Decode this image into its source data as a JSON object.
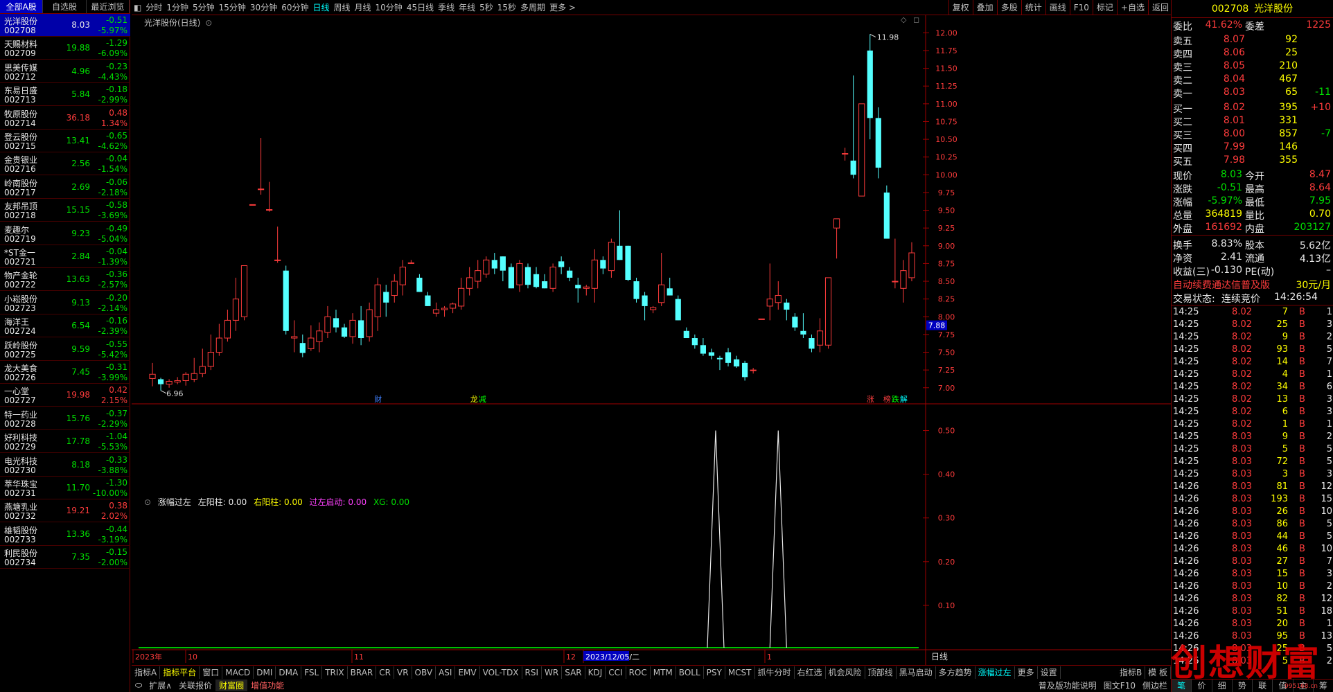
{
  "left_tabs": [
    "全部A股",
    "自选股",
    "最近浏览"
  ],
  "stocks": [
    {
      "name": "光洋股份",
      "code": "002708",
      "price": "8.03",
      "change": "-0.51",
      "pct": "-5.97%",
      "dir": "dn"
    },
    {
      "name": "天赐材料",
      "code": "002709",
      "price": "19.88",
      "change": "-1.29",
      "pct": "-6.09%",
      "dir": "dn"
    },
    {
      "name": "思美传媒",
      "code": "002712",
      "price": "4.96",
      "change": "-0.23",
      "pct": "-4.43%",
      "dir": "dn"
    },
    {
      "name": "东易日盛",
      "code": "002713",
      "price": "5.84",
      "change": "-0.18",
      "pct": "-2.99%",
      "dir": "dn"
    },
    {
      "name": "牧原股份",
      "code": "002714",
      "price": "36.18",
      "change": "0.48",
      "pct": "1.34%",
      "dir": "up"
    },
    {
      "name": "登云股份",
      "code": "002715",
      "price": "13.41",
      "change": "-0.65",
      "pct": "-4.62%",
      "dir": "dn"
    },
    {
      "name": "金贵银业",
      "code": "002716",
      "price": "2.56",
      "change": "-0.04",
      "pct": "-1.54%",
      "dir": "dn"
    },
    {
      "name": "岭南股份",
      "code": "002717",
      "price": "2.69",
      "change": "-0.06",
      "pct": "-2.18%",
      "dir": "dn"
    },
    {
      "name": "友邦吊顶",
      "code": "002718",
      "price": "15.15",
      "change": "-0.58",
      "pct": "-3.69%",
      "dir": "dn"
    },
    {
      "name": "麦趣尔",
      "code": "002719",
      "price": "9.23",
      "change": "-0.49",
      "pct": "-5.04%",
      "dir": "dn"
    },
    {
      "name": "*ST金一",
      "code": "002721",
      "price": "2.84",
      "change": "-0.04",
      "pct": "-1.39%",
      "dir": "dn"
    },
    {
      "name": "物产金轮",
      "code": "002722",
      "price": "13.63",
      "change": "-0.36",
      "pct": "-2.57%",
      "dir": "dn"
    },
    {
      "name": "小崧股份",
      "code": "002723",
      "price": "9.13",
      "change": "-0.20",
      "pct": "-2.14%",
      "dir": "dn"
    },
    {
      "name": "海洋王",
      "code": "002724",
      "price": "6.54",
      "change": "-0.16",
      "pct": "-2.39%",
      "dir": "dn"
    },
    {
      "name": "跃岭股份",
      "code": "002725",
      "price": "9.59",
      "change": "-0.55",
      "pct": "-5.42%",
      "dir": "dn"
    },
    {
      "name": "龙大美食",
      "code": "002726",
      "price": "7.45",
      "change": "-0.31",
      "pct": "-3.99%",
      "dir": "dn"
    },
    {
      "name": "一心堂",
      "code": "002727",
      "price": "19.98",
      "change": "0.42",
      "pct": "2.15%",
      "dir": "up"
    },
    {
      "name": "特一药业",
      "code": "002728",
      "price": "15.76",
      "change": "-0.37",
      "pct": "-2.29%",
      "dir": "dn"
    },
    {
      "name": "好利科技",
      "code": "002729",
      "price": "17.78",
      "change": "-1.04",
      "pct": "-5.53%",
      "dir": "dn"
    },
    {
      "name": "电光科技",
      "code": "002730",
      "price": "8.18",
      "change": "-0.33",
      "pct": "-3.88%",
      "dir": "dn"
    },
    {
      "name": "萃华珠宝",
      "code": "002731",
      "price": "11.70",
      "change": "-1.30",
      "pct": "-10.00%",
      "dir": "dn"
    },
    {
      "name": "燕塘乳业",
      "code": "002732",
      "price": "19.21",
      "change": "0.38",
      "pct": "2.02%",
      "dir": "up"
    },
    {
      "name": "雄韬股份",
      "code": "002733",
      "price": "13.36",
      "change": "-0.44",
      "pct": "-3.19%",
      "dir": "dn"
    },
    {
      "name": "利民股份",
      "code": "002734",
      "price": "7.35",
      "change": "-0.15",
      "pct": "-2.00%",
      "dir": "dn"
    }
  ],
  "period_tabs": [
    "分时",
    "1分钟",
    "5分钟",
    "15分钟",
    "30分钟",
    "60分钟",
    "日线",
    "周线",
    "月线",
    "10分钟",
    "45日线",
    "季线",
    "年线",
    "5秒",
    "15秒",
    "多周期",
    "更多 >"
  ],
  "active_period": "日线",
  "toolbar_right": [
    "复权",
    "叠加",
    "多股",
    "统计",
    "画线",
    "F10",
    "标记",
    "+自选",
    "返回"
  ],
  "chart_title": "光洋股份(日线)",
  "chart_data": {
    "type": "candlestick",
    "title": "光洋股份(日线)",
    "ylim": [
      6.9,
      12.15
    ],
    "yticks": [
      "12.00",
      "11.75",
      "11.50",
      "11.25",
      "11.00",
      "10.75",
      "10.50",
      "10.25",
      "10.00",
      "9.75",
      "9.50",
      "9.25",
      "9.00",
      "8.75",
      "8.50",
      "8.25",
      "8.00",
      "7.75",
      "7.50",
      "7.25",
      "7.00"
    ],
    "max_label": "11.98",
    "min_label": "6.96",
    "current_price_label": "7.88",
    "candles": [
      {
        "o": 7.13,
        "h": 7.35,
        "l": 7.02,
        "c": 7.19
      },
      {
        "o": 7.12,
        "h": 7.14,
        "l": 6.96,
        "c": 7.05
      },
      {
        "o": 7.05,
        "h": 7.12,
        "l": 7.0,
        "c": 7.09
      },
      {
        "o": 7.08,
        "h": 7.15,
        "l": 7.05,
        "c": 7.1
      },
      {
        "o": 7.1,
        "h": 7.22,
        "l": 7.03,
        "c": 7.19
      },
      {
        "o": 7.12,
        "h": 7.42,
        "l": 7.08,
        "c": 7.2
      },
      {
        "o": 7.2,
        "h": 7.55,
        "l": 7.15,
        "c": 7.3
      },
      {
        "o": 7.3,
        "h": 7.75,
        "l": 7.25,
        "c": 7.5
      },
      {
        "o": 7.5,
        "h": 7.9,
        "l": 7.45,
        "c": 7.7
      },
      {
        "o": 7.7,
        "h": 8.1,
        "l": 7.65,
        "c": 7.95
      },
      {
        "o": 7.95,
        "h": 8.55,
        "l": 7.8,
        "c": 8.25
      },
      {
        "o": 8.0,
        "h": 8.72,
        "l": 7.95,
        "c": 8.72
      },
      {
        "o": 9.58,
        "h": 9.58,
        "l": 9.58,
        "c": 9.58
      },
      {
        "o": 9.8,
        "h": 10.52,
        "l": 9.72,
        "c": 9.8
      },
      {
        "o": 9.51,
        "h": 9.9,
        "l": 9.48,
        "c": 9.51
      },
      {
        "o": 8.8,
        "h": 9.27,
        "l": 8.76,
        "c": 8.8
      },
      {
        "o": 8.65,
        "h": 8.72,
        "l": 7.75,
        "c": 7.8
      },
      {
        "o": 7.7,
        "h": 7.95,
        "l": 7.5,
        "c": 7.72
      },
      {
        "o": 7.63,
        "h": 7.75,
        "l": 7.43,
        "c": 7.49
      },
      {
        "o": 7.55,
        "h": 7.88,
        "l": 7.52,
        "c": 7.7
      },
      {
        "o": 7.65,
        "h": 7.92,
        "l": 7.5,
        "c": 7.8
      },
      {
        "o": 7.78,
        "h": 8.15,
        "l": 7.7,
        "c": 8.0
      },
      {
        "o": 7.98,
        "h": 8.1,
        "l": 7.78,
        "c": 7.85
      },
      {
        "o": 7.85,
        "h": 7.9,
        "l": 7.7,
        "c": 7.72
      },
      {
        "o": 7.72,
        "h": 8.05,
        "l": 7.62,
        "c": 7.95
      },
      {
        "o": 7.95,
        "h": 8.15,
        "l": 7.6,
        "c": 7.7
      },
      {
        "o": 7.72,
        "h": 8.2,
        "l": 7.65,
        "c": 8.1
      },
      {
        "o": 8.0,
        "h": 8.55,
        "l": 7.8,
        "c": 8.45
      },
      {
        "o": 8.35,
        "h": 8.45,
        "l": 8.0,
        "c": 8.2
      },
      {
        "o": 8.3,
        "h": 8.6,
        "l": 8.2,
        "c": 8.5
      },
      {
        "o": 8.45,
        "h": 8.8,
        "l": 8.3,
        "c": 8.7
      },
      {
        "o": 8.76,
        "h": 8.8,
        "l": 8.75,
        "c": 8.76
      },
      {
        "o": 8.55,
        "h": 8.6,
        "l": 8.35,
        "c": 8.35
      },
      {
        "o": 8.3,
        "h": 8.35,
        "l": 8.15,
        "c": 8.15
      },
      {
        "o": 8.05,
        "h": 8.2,
        "l": 8.0,
        "c": 8.1
      },
      {
        "o": 8.1,
        "h": 8.15,
        "l": 8.0,
        "c": 8.12
      },
      {
        "o": 8.12,
        "h": 8.2,
        "l": 8.05,
        "c": 8.18
      },
      {
        "o": 8.15,
        "h": 8.55,
        "l": 8.1,
        "c": 8.4
      },
      {
        "o": 8.4,
        "h": 8.7,
        "l": 8.3,
        "c": 8.55
      },
      {
        "o": 8.5,
        "h": 8.8,
        "l": 8.4,
        "c": 8.65
      },
      {
        "o": 8.6,
        "h": 8.85,
        "l": 8.55,
        "c": 8.8
      },
      {
        "o": 8.8,
        "h": 8.9,
        "l": 8.6,
        "c": 8.68
      },
      {
        "o": 8.85,
        "h": 8.85,
        "l": 8.5,
        "c": 8.65
      },
      {
        "o": 8.7,
        "h": 8.75,
        "l": 8.4,
        "c": 8.4
      },
      {
        "o": 8.45,
        "h": 8.8,
        "l": 8.35,
        "c": 8.75
      },
      {
        "o": 8.7,
        "h": 8.75,
        "l": 8.4,
        "c": 8.45
      },
      {
        "o": 8.6,
        "h": 8.7,
        "l": 8.4,
        "c": 8.42
      },
      {
        "o": 8.5,
        "h": 8.6,
        "l": 8.4,
        "c": 8.4
      },
      {
        "o": 8.4,
        "h": 8.75,
        "l": 8.35,
        "c": 8.7
      },
      {
        "o": 8.78,
        "h": 8.85,
        "l": 8.6,
        "c": 8.7
      },
      {
        "o": 8.65,
        "h": 8.7,
        "l": 8.5,
        "c": 8.55
      },
      {
        "o": 8.45,
        "h": 8.55,
        "l": 8.2,
        "c": 8.4
      },
      {
        "o": 8.4,
        "h": 8.45,
        "l": 8.3,
        "c": 8.42
      },
      {
        "o": 8.4,
        "h": 8.95,
        "l": 8.2,
        "c": 8.8
      },
      {
        "o": 8.8,
        "h": 8.85,
        "l": 8.6,
        "c": 8.68
      },
      {
        "o": 8.65,
        "h": 9.1,
        "l": 8.55,
        "c": 9.05
      },
      {
        "o": 9.0,
        "h": 9.5,
        "l": 8.8,
        "c": 8.8
      },
      {
        "o": 9.0,
        "h": 9.0,
        "l": 8.5,
        "c": 8.52
      },
      {
        "o": 8.5,
        "h": 8.55,
        "l": 8.2,
        "c": 8.25
      },
      {
        "o": 8.3,
        "h": 8.35,
        "l": 7.95,
        "c": 8.15
      },
      {
        "o": 8.1,
        "h": 8.15,
        "l": 8.05,
        "c": 8.13
      },
      {
        "o": 8.2,
        "h": 8.9,
        "l": 8.15,
        "c": 8.45
      },
      {
        "o": 8.4,
        "h": 8.55,
        "l": 8.3,
        "c": 8.3
      },
      {
        "o": 8.25,
        "h": 8.3,
        "l": 7.95,
        "c": 7.95
      },
      {
        "o": 7.8,
        "h": 7.85,
        "l": 7.7,
        "c": 7.7
      },
      {
        "o": 7.7,
        "h": 7.75,
        "l": 7.55,
        "c": 7.6
      },
      {
        "o": 7.6,
        "h": 7.7,
        "l": 7.45,
        "c": 7.48
      },
      {
        "o": 7.5,
        "h": 7.55,
        "l": 7.4,
        "c": 7.45
      },
      {
        "o": 7.42,
        "h": 7.45,
        "l": 7.25,
        "c": 7.4
      },
      {
        "o": 7.5,
        "h": 7.56,
        "l": 7.3,
        "c": 7.35
      },
      {
        "o": 7.4,
        "h": 7.45,
        "l": 7.28,
        "c": 7.3
      },
      {
        "o": 7.35,
        "h": 7.38,
        "l": 7.1,
        "c": 7.15
      },
      {
        "o": 7.25,
        "h": 7.28,
        "l": 7.2,
        "c": 7.25
      },
      {
        "o": 7.97,
        "h": 7.97,
        "l": 7.97,
        "c": 7.97
      },
      {
        "o": 8.15,
        "h": 8.75,
        "l": 7.95,
        "c": 8.25
      },
      {
        "o": 8.2,
        "h": 8.5,
        "l": 8.1,
        "c": 8.3
      },
      {
        "o": 8.2,
        "h": 8.25,
        "l": 7.95,
        "c": 8.1
      },
      {
        "o": 8.0,
        "h": 8.05,
        "l": 7.8,
        "c": 7.85
      },
      {
        "o": 7.8,
        "h": 8.05,
        "l": 7.7,
        "c": 7.75
      },
      {
        "o": 7.7,
        "h": 7.75,
        "l": 7.5,
        "c": 7.55
      },
      {
        "o": 7.6,
        "h": 7.98,
        "l": 7.5,
        "c": 7.8
      },
      {
        "o": 7.6,
        "h": 8.55,
        "l": 7.55,
        "c": 8.55
      },
      {
        "o": 9.25,
        "h": 9.38,
        "l": 8.82,
        "c": 9.38
      },
      {
        "o": 10.3,
        "h": 10.38,
        "l": 10.2,
        "c": 10.3
      },
      {
        "o": 10.2,
        "h": 11.4,
        "l": 9.95,
        "c": 10.0
      },
      {
        "o": 9.7,
        "h": 11.0,
        "l": 9.7,
        "c": 11.0
      },
      {
        "o": 11.75,
        "h": 11.98,
        "l": 10.5,
        "c": 10.8
      },
      {
        "o": 10.8,
        "h": 10.95,
        "l": 9.95,
        "c": 10.1
      },
      {
        "o": 9.75,
        "h": 9.85,
        "l": 9.1,
        "c": 9.1
      },
      {
        "o": 8.5,
        "h": 9.1,
        "l": 8.4,
        "c": 8.5
      },
      {
        "o": 8.4,
        "h": 8.8,
        "l": 8.2,
        "c": 8.65
      },
      {
        "o": 8.55,
        "h": 9.05,
        "l": 8.5,
        "c": 8.9
      }
    ],
    "date_labels": [
      "2023年",
      "10",
      "11",
      "12",
      "2023/12/05/二",
      "1"
    ],
    "markers": [
      {
        "t": "财",
        "color": "#4080ff"
      },
      {
        "t": "龙",
        "color": "#ffff00"
      },
      {
        "t": "减",
        "color": "#00ff00"
      },
      {
        "t": "涨",
        "color": "#ff4040"
      },
      {
        "t": "榜",
        "color": "#ff4040"
      },
      {
        "t": "跌",
        "color": "#00ff00"
      },
      {
        "t": "解",
        "color": "#00ffff"
      }
    ],
    "indicator": {
      "name": "涨幅过左",
      "yticks": [
        "0.50",
        "0.40",
        "0.30",
        "0.20",
        "0.10"
      ],
      "ylim": [
        0,
        0.55
      ],
      "spikes": [
        {
          "value": 0.5
        },
        {
          "value": 0.5
        }
      ]
    }
  },
  "indicator_title": {
    "name": "涨幅过左",
    "left_label": "左阳柱: 0.00",
    "right_label": "右阳柱: 0.00",
    "start_label": "过左启动: 0.00",
    "xg_label": "XG: 0.00"
  },
  "bottom_tabs": [
    "指标A",
    "指标平台",
    "窗口",
    "MACD",
    "DMI",
    "DMA",
    "FSL",
    "TRIX",
    "BRAR",
    "CR",
    "VR",
    "OBV",
    "ASI",
    "EMV",
    "VOL-TDX",
    "RSI",
    "WR",
    "SAR",
    "KDJ",
    "CCI",
    "ROC",
    "MTM",
    "BOLL",
    "PSY",
    "MCST",
    "抓牛分时",
    "右红选",
    "机会风险",
    "顶部线",
    "黑马启动",
    "多方趋势",
    "涨幅过左",
    "更多",
    "设置"
  ],
  "bottom_right_tabs": [
    "指标B",
    "模 板"
  ],
  "bottom_tabs2": [
    "扩展∧",
    "关联报价",
    "财富圈",
    "增值功能"
  ],
  "bottom_right_info": [
    "普及版功能说明",
    "图文F10",
    "侧边栏"
  ],
  "quote": {
    "code": "002708",
    "name": "光洋股份",
    "webi": "委比",
    "webi_val": "41.62%",
    "weicha": "委差",
    "weicha_val": "1225",
    "asks": [
      {
        "l": "卖五",
        "p": "8.07",
        "v": "92",
        "x": ""
      },
      {
        "l": "卖四",
        "p": "8.06",
        "v": "25",
        "x": ""
      },
      {
        "l": "卖三",
        "p": "8.05",
        "v": "210",
        "x": ""
      },
      {
        "l": "卖二",
        "p": "8.04",
        "v": "467",
        "x": ""
      },
      {
        "l": "卖一",
        "p": "8.03",
        "v": "65",
        "x": "-11"
      }
    ],
    "bids": [
      {
        "l": "买一",
        "p": "8.02",
        "v": "395",
        "x": "+10"
      },
      {
        "l": "买二",
        "p": "8.01",
        "v": "331",
        "x": ""
      },
      {
        "l": "买三",
        "p": "8.00",
        "v": "857",
        "x": "-7"
      },
      {
        "l": "买四",
        "p": "7.99",
        "v": "146",
        "x": ""
      },
      {
        "l": "买五",
        "p": "7.98",
        "v": "355",
        "x": ""
      }
    ],
    "stats": [
      {
        "a": "现价",
        "av": "8.03",
        "ac": "dn",
        "b": "今开",
        "bv": "8.47",
        "bc": "up"
      },
      {
        "a": "涨跌",
        "av": "-0.51",
        "ac": "dn",
        "b": "最高",
        "bv": "8.64",
        "bc": "up"
      },
      {
        "a": "涨幅",
        "av": "-5.97%",
        "ac": "dn",
        "b": "最低",
        "bv": "7.95",
        "bc": "dn"
      },
      {
        "a": "总量",
        "av": "364819",
        "ac": "y",
        "b": "量比",
        "bv": "0.70",
        "bc": "y"
      },
      {
        "a": "外盘",
        "av": "161692",
        "ac": "up",
        "b": "内盘",
        "bv": "203127",
        "bc": "dn"
      },
      {
        "a": "换手",
        "av": "8.83%",
        "ac": "w",
        "b": "股本",
        "bv": "5.62亿",
        "bc": "w"
      },
      {
        "a": "净资",
        "av": "2.41",
        "ac": "w",
        "b": "流通",
        "bv": "4.13亿",
        "bc": "w"
      },
      {
        "a": "收益(三)",
        "av": "-0.130",
        "ac": "w",
        "b": "PE(动)",
        "bv": "–",
        "bc": "w"
      }
    ],
    "promo": "自动续费通达信普及版",
    "promo_price": "30元/月",
    "status_label": "交易状态:",
    "status_val": "连续竞价",
    "status_time": "14:26:54",
    "ticks": [
      [
        "14:25",
        "8.02",
        "7",
        "B",
        "1"
      ],
      [
        "14:25",
        "8.02",
        "25",
        "B",
        "3"
      ],
      [
        "14:25",
        "8.02",
        "9",
        "B",
        "2"
      ],
      [
        "14:25",
        "8.02",
        "93",
        "B",
        "5"
      ],
      [
        "14:25",
        "8.02",
        "14",
        "B",
        "7"
      ],
      [
        "14:25",
        "8.02",
        "4",
        "B",
        "1"
      ],
      [
        "14:25",
        "8.02",
        "34",
        "B",
        "6"
      ],
      [
        "14:25",
        "8.02",
        "13",
        "B",
        "3"
      ],
      [
        "14:25",
        "8.02",
        "6",
        "B",
        "3"
      ],
      [
        "14:25",
        "8.02",
        "1",
        "B",
        "1"
      ],
      [
        "14:25",
        "8.03",
        "9",
        "B",
        "2"
      ],
      [
        "14:25",
        "8.03",
        "5",
        "B",
        "5"
      ],
      [
        "14:25",
        "8.03",
        "72",
        "B",
        "5"
      ],
      [
        "14:25",
        "8.03",
        "3",
        "B",
        "3"
      ],
      [
        "14:26",
        "8.03",
        "81",
        "B",
        "12"
      ],
      [
        "14:26",
        "8.03",
        "193",
        "B",
        "15"
      ],
      [
        "14:26",
        "8.03",
        "26",
        "B",
        "10"
      ],
      [
        "14:26",
        "8.03",
        "86",
        "B",
        "5"
      ],
      [
        "14:26",
        "8.03",
        "44",
        "B",
        "5"
      ],
      [
        "14:26",
        "8.03",
        "46",
        "B",
        "10"
      ],
      [
        "14:26",
        "8.03",
        "27",
        "B",
        "7"
      ],
      [
        "14:26",
        "8.03",
        "15",
        "B",
        "3"
      ],
      [
        "14:26",
        "8.03",
        "10",
        "B",
        "2"
      ],
      [
        "14:26",
        "8.03",
        "82",
        "B",
        "12"
      ],
      [
        "14:26",
        "8.03",
        "51",
        "B",
        "18"
      ],
      [
        "14:26",
        "8.03",
        "20",
        "B",
        "1"
      ],
      [
        "14:26",
        "8.03",
        "95",
        "B",
        "13"
      ],
      [
        "14:26",
        "8.03",
        "25",
        "B",
        "5"
      ],
      [
        "14:26",
        "8.03",
        "5",
        "B",
        "2"
      ]
    ]
  },
  "right_bottom_tabs": [
    "笔",
    "价",
    "细",
    "势",
    "联",
    "值",
    "主",
    "筹"
  ],
  "watermark": "创想财富",
  "watermark_url": "995168.cn"
}
